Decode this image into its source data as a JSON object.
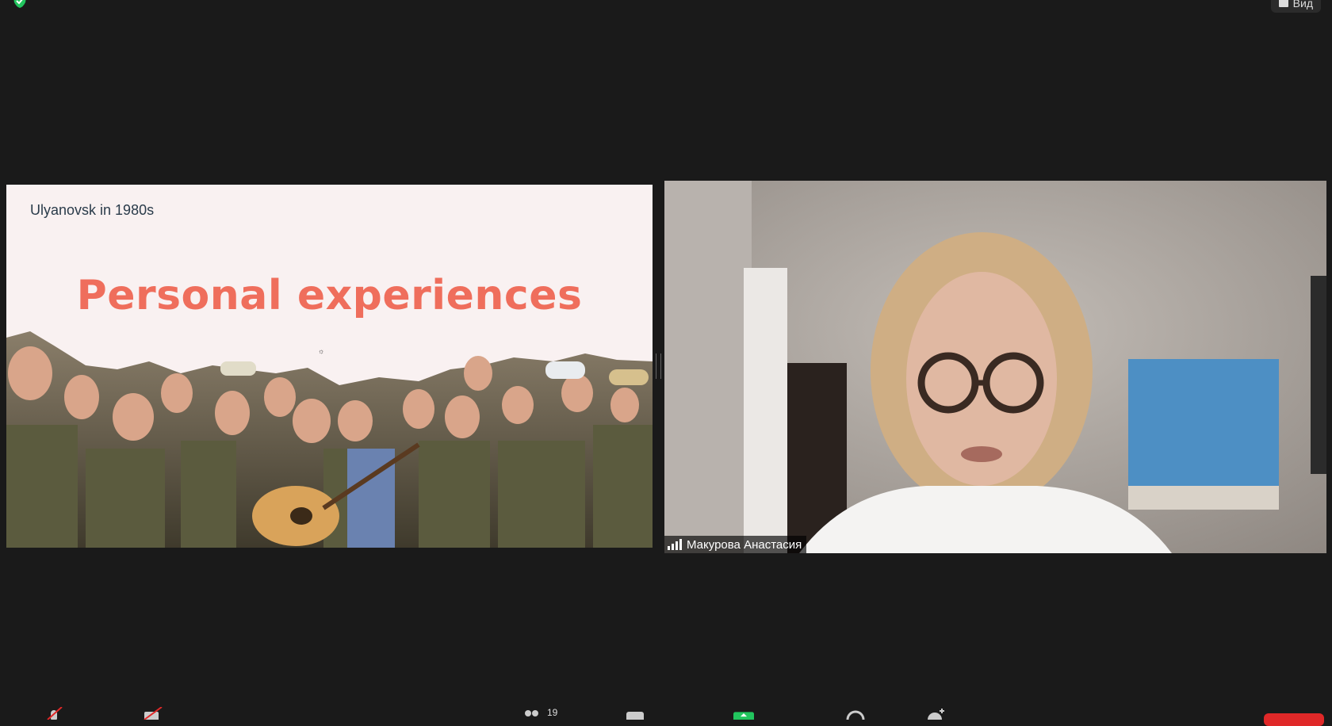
{
  "top": {
    "view_label": "Вид"
  },
  "slide": {
    "subtitle": "Ulyanovsk in 1980s",
    "title": "Personal experiences",
    "title_color": "#ef6e5c"
  },
  "participant": {
    "name": "Макурова Анастасия"
  },
  "toolbar": {
    "participants_count": "19",
    "share_color": "#22c55e",
    "end_color": "#e02828"
  }
}
